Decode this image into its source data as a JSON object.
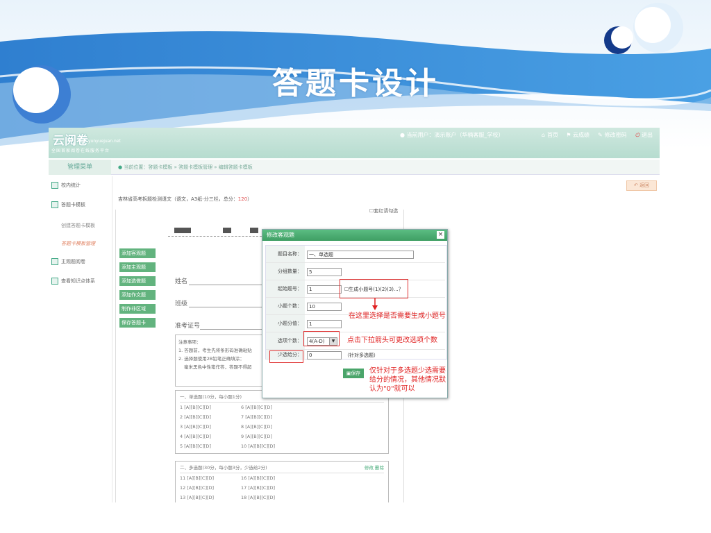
{
  "slide": {
    "title": "答题卡设计"
  },
  "app": {
    "logo": "云阅卷",
    "logo_en": "yunyuejuan.net",
    "logo_sub": "全国首家阅卷在线服务平台",
    "user_info": "当前用户：演示账户（华楠客服_学校）",
    "nav": [
      {
        "icon": "home-icon",
        "label": "首页"
      },
      {
        "icon": "flag-icon",
        "label": "云成绩"
      },
      {
        "icon": "pencil-icon",
        "label": "修改密码"
      },
      {
        "icon": "power-icon",
        "label": "退出"
      }
    ],
    "menu_head": "管理菜单",
    "breadcrumb": "当前位置：答题卡模板 » 答题卡模板管理 » 编辑答题卡模板",
    "back_button": "返回",
    "sidebar": {
      "items": [
        {
          "icon": "chart-icon",
          "label": "校内统计"
        },
        {
          "icon": "card-icon",
          "label": "答题卡模板"
        },
        {
          "icon": "doc-icon",
          "label": "主观题阅卷"
        },
        {
          "icon": "tree-icon",
          "label": "查看知识点体系"
        }
      ],
      "sub_items": [
        {
          "label": "创建答题卡模板",
          "active": false
        },
        {
          "label": "答题卡模板管理",
          "active": true
        }
      ]
    }
  },
  "paper": {
    "title_prefix": "吉林省高考拆题检测语文（语文，A3纸-分三栏，总分：",
    "title_score": "120",
    "title_suffix": "）",
    "red_check_label": "套红请勾选",
    "side_buttons": [
      "添加客观题",
      "添加主观题",
      "添加选做题",
      "添加作文题",
      "制作非区域",
      "保存答题卡"
    ],
    "name_label": "姓名",
    "class_label": "班级",
    "ticket_label": "准考证号",
    "notes": {
      "title": "注意事项：",
      "line1": "1. 答题前，考生先将条形码准确粘贴",
      "line2": "2. 选择题使用2B铅笔正确填涂：",
      "line3": "毫米黑色中性笔作答，答题不得超"
    },
    "section1": {
      "header": "一、单选题(10分，每小题1分)",
      "col1": [
        "1 [A][B][C][D]",
        "2 [A][B][C][D]",
        "3 [A][B][C][D]",
        "4 [A][B][C][D]",
        "5 [A][B][C][D]"
      ],
      "col2": [
        "6 [A][B][C][D]",
        "7 [A][B][C][D]",
        "8 [A][B][C][D]",
        "9 [A][B][C][D]",
        "10 [A][B][C][D]"
      ]
    },
    "section2": {
      "header": "二、多选题(30分，每小题3分，少选给2分)",
      "edit": "修改",
      "delete": "删除",
      "col1": [
        "11 [A][B][C][D]",
        "12 [A][B][C][D]",
        "13 [A][B][C][D]"
      ],
      "col2": [
        "16 [A][B][C][D]",
        "17 [A][B][C][D]",
        "18 [A][B][C][D]"
      ]
    }
  },
  "dialog": {
    "title": "修改客观题",
    "fields": [
      {
        "label": "题目名称：",
        "value": "一、单选题"
      },
      {
        "label": "分组数量：",
        "value": "5"
      },
      {
        "label": "起始题号：",
        "value": "1"
      },
      {
        "label": "小题个数：",
        "value": "10"
      },
      {
        "label": "小题分值：",
        "value": "1"
      },
      {
        "label": "选项个数：",
        "value": "4(A-D)"
      },
      {
        "label": "少选给分：",
        "value": "0"
      }
    ],
    "gen_checkbox_label": "生成小题号(1)(2)(3)...？",
    "multi_note": "（针对多选题）",
    "save_label": "保存"
  },
  "annotations": {
    "note1": "在这里选择是否需要生成小题号",
    "note2": "点击下拉箭头可更改选项个数",
    "note3_l1": "仅针对于多选题少选需要",
    "note3_l2": "给分的情况，其他情况默",
    "note3_l3": "认为\"0\"就可以"
  },
  "colors": {
    "banner_blue": "#3d8fd8",
    "app_green": "#4aa56a",
    "annotation_red": "#e02020"
  }
}
